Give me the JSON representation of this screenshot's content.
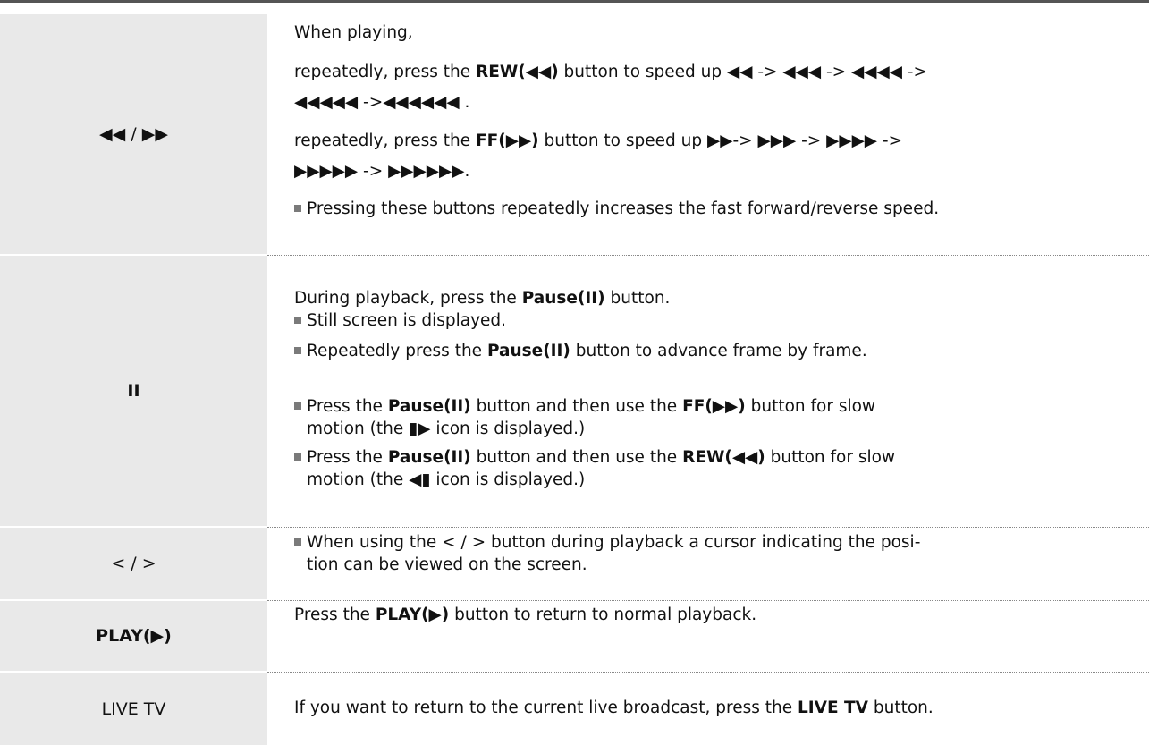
{
  "rows": [
    {
      "key": "◀◀ / ▶▶",
      "lines": [
        [
          "When playing,"
        ],
        [
          "repeatedly, press the ",
          "REW(◀◀)",
          " button to speed up ◀◀ -> ◀◀◀ -> ◀◀◀◀ ->"
        ],
        [
          "◀◀◀◀◀ ->◀◀◀◀◀◀ ."
        ],
        [
          "repeatedly, press the ",
          "FF(▶▶)",
          " button to speed up ▶▶-> ▶▶▶ -> ▶▶▶▶ ->"
        ],
        [
          "▶▶▶▶▶ -> ▶▶▶▶▶▶."
        ],
        [
          "Pressing these buttons repeatedly increases the fast forward/reverse speed."
        ]
      ]
    },
    {
      "key": "II",
      "lines": [
        [
          "During playback, press the ",
          "Pause(II)",
          " button."
        ],
        [
          "Still screen is displayed."
        ],
        [
          "Repeatedly press the ",
          "Pause(II)",
          " button to advance frame by frame."
        ],
        [
          "Press the ",
          "Pause(II)",
          " button and then use the ",
          "FF(▶▶)",
          " button for slow"
        ],
        [
          "motion (the ▮▶ icon is displayed.)"
        ],
        [
          "Press the ",
          "Pause(II)",
          " button and then use the ",
          "REW(◀◀)",
          " button for slow"
        ],
        [
          "motion (the ◀▮ icon is displayed.)"
        ]
      ]
    },
    {
      "key": "< / >",
      "lines": [
        [
          "When using the  < / >  button during playback a cursor indicating the posi-"
        ],
        [
          "tion can be viewed on the screen."
        ]
      ]
    },
    {
      "key": "PLAY(▶)",
      "lines": [
        [
          "Press the ",
          "PLAY(▶)",
          " button to return to normal playback."
        ]
      ]
    },
    {
      "key": "LIVE TV",
      "lines": [
        [
          "If you want to return to the current live broadcast, press the ",
          "LIVE TV",
          " button."
        ]
      ]
    }
  ]
}
